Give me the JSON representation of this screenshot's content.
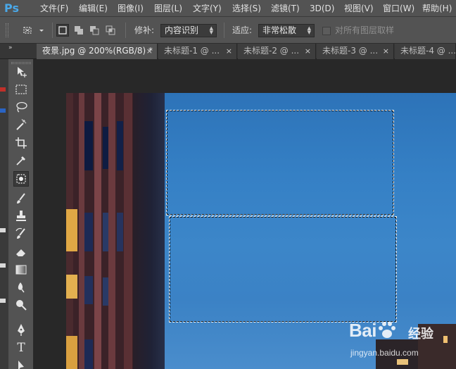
{
  "app": {
    "logo": "Ps"
  },
  "menu": [
    {
      "label": "文件(F)"
    },
    {
      "label": "编辑(E)"
    },
    {
      "label": "图像(I)"
    },
    {
      "label": "图层(L)"
    },
    {
      "label": "文字(Y)"
    },
    {
      "label": "选择(S)"
    },
    {
      "label": "滤镜(T)"
    },
    {
      "label": "3D(D)"
    },
    {
      "label": "视图(V)"
    },
    {
      "label": "窗口(W)"
    },
    {
      "label": "帮助(H)"
    }
  ],
  "options": {
    "tool_preset_icon": "patch-tool-icon",
    "mode_icons": [
      "new-selection-icon",
      "add-to-selection-icon",
      "subtract-from-selection-icon",
      "intersect-selection-icon"
    ],
    "repair_label": "修补:",
    "repair_value": "内容识别",
    "adapt_label": "适应:",
    "adapt_value": "非常松散",
    "sample_all_label": "对所有图层取样",
    "sample_all_checked": false
  },
  "tabs": [
    {
      "label": "夜景.jpg @ 200%(RGB/8) *",
      "active": true
    },
    {
      "label": "未标题-1 @ ...",
      "active": false
    },
    {
      "label": "未标题-2 @ ...",
      "active": false
    },
    {
      "label": "未标题-3 @ ...",
      "active": false
    },
    {
      "label": "未标题-4 @ ...",
      "active": false
    }
  ],
  "tab_close_glyph": "×",
  "panel_collapse_glyph": "»",
  "tools": [
    {
      "name": "move-tool-icon"
    },
    {
      "name": "marquee-tool-icon"
    },
    {
      "name": "lasso-tool-icon"
    },
    {
      "name": "magic-wand-tool-icon"
    },
    {
      "name": "crop-tool-icon"
    },
    {
      "name": "eyedropper-tool-icon"
    },
    {
      "name": "patch-tool-icon",
      "active": true
    },
    {
      "name": "brush-tool-icon"
    },
    {
      "name": "clone-stamp-tool-icon"
    },
    {
      "name": "history-brush-tool-icon"
    },
    {
      "name": "eraser-tool-icon"
    },
    {
      "name": "gradient-tool-icon"
    },
    {
      "name": "blur-tool-icon"
    },
    {
      "name": "dodge-tool-icon"
    },
    {
      "name": "pen-tool-icon"
    },
    {
      "name": "type-tool-icon"
    },
    {
      "name": "path-selection-tool-icon"
    }
  ],
  "type_tool_glyph": "T",
  "colors": {
    "accent": "#4aa8e8",
    "sky": "#3580c5",
    "chrome": "#535353"
  },
  "watermark": {
    "brand": "Bai",
    "brand2": "经验",
    "url": "jingyan.baidu.com"
  }
}
